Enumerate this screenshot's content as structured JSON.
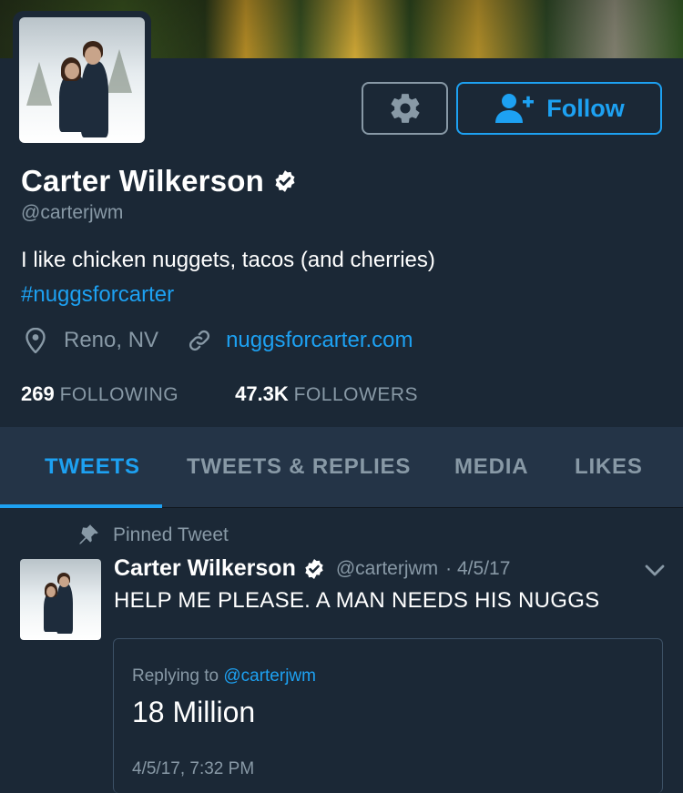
{
  "profile": {
    "name": "Carter Wilkerson",
    "handle": "@carterjwm",
    "bio": "I like chicken nuggets, tacos (and cherries)",
    "hashtag": "#nuggsforcarter",
    "location": "Reno, NV",
    "website": "nuggsforcarter.com",
    "following_count": "269",
    "following_label": "FOLLOWING",
    "followers_count": "47.3K",
    "followers_label": "FOLLOWERS"
  },
  "buttons": {
    "follow_label": "Follow",
    "settings_icon": "gear-icon",
    "follow_icon": "add-user-icon"
  },
  "tabs": [
    {
      "label": "TWEETS",
      "active": true
    },
    {
      "label": "TWEETS & REPLIES",
      "active": false
    },
    {
      "label": "MEDIA",
      "active": false
    },
    {
      "label": "LIKES",
      "active": false
    }
  ],
  "pinned_tweet": {
    "pinned_label": "Pinned Tweet",
    "author_name": "Carter Wilkerson",
    "author_handle": "@carterjwm",
    "date": "· 4/5/17",
    "text": "HELP ME PLEASE. A MAN NEEDS HIS NUGGS",
    "quote": {
      "replying_prefix": "Replying to",
      "replying_to": "@carterjwm",
      "text": "18 Million",
      "timestamp": "4/5/17, 7:32 PM"
    }
  },
  "colors": {
    "background": "#1b2836",
    "tab_bar": "#243447",
    "accent": "#1da1f2",
    "secondary_text": "#8899a6"
  }
}
